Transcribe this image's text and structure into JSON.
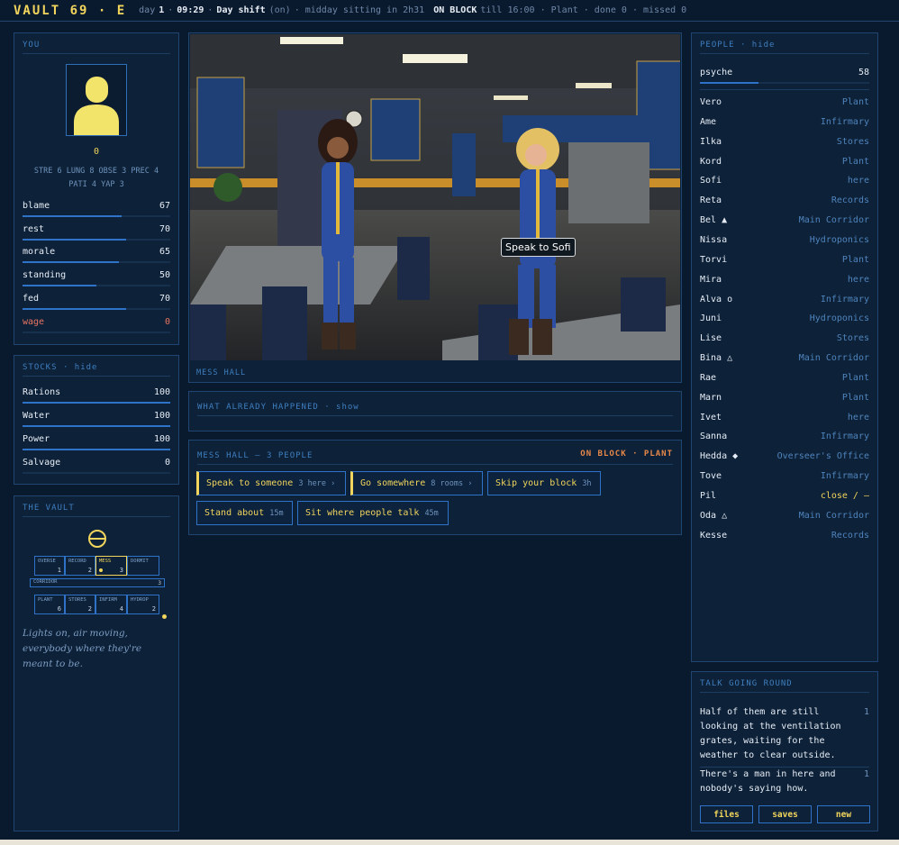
{
  "topbar": {
    "title": "VAULT 69 · E",
    "day_label": "day",
    "day": "1",
    "sep1": "·",
    "time": "09:29",
    "sep2": "·",
    "shift": "Day shift",
    "shift_status": "(on)",
    "sitting": "· midday sitting in 2h31",
    "block_label": "ON BLOCK",
    "block_rest": "till 16:00 · Plant · done 0 · missed 0"
  },
  "you": {
    "title": "YOU",
    "zero": "0",
    "attrs_line1": "STRE 6  LUNG 8  OBSE 3  PREC 4",
    "attrs_line2": "PATI 4  YAP 3",
    "stats": [
      {
        "label": "blame",
        "value": "67",
        "fill": 0.67
      },
      {
        "label": "rest",
        "value": "70",
        "fill": 0.7
      },
      {
        "label": "morale",
        "value": "65",
        "fill": 0.65
      },
      {
        "label": "standing",
        "value": "50",
        "fill": 0.5
      },
      {
        "label": "fed",
        "value": "70",
        "fill": 0.7
      },
      {
        "label": "wage",
        "value": "0",
        "fill": 0
      }
    ]
  },
  "stocks": {
    "title": "STOCKS",
    "toggle": "· hide",
    "items": [
      {
        "label": "Rations",
        "value": "100",
        "fill": 1
      },
      {
        "label": "Water",
        "value": "100",
        "fill": 1
      },
      {
        "label": "Power",
        "value": "100",
        "fill": 1
      },
      {
        "label": "Salvage",
        "value": "0",
        "fill": 0
      }
    ]
  },
  "vault": {
    "title": "THE VAULT",
    "rooms": [
      {
        "name": "OVERSE",
        "count": "1"
      },
      {
        "name": "RECORD",
        "count": "2"
      },
      {
        "name": "MESS",
        "count": "3"
      },
      {
        "name": "DORMIT",
        "count": ""
      },
      {
        "name": "CORRIDOR",
        "count": "3"
      },
      {
        "name": "PLANT",
        "count": "6"
      },
      {
        "name": "STORES",
        "count": "2"
      },
      {
        "name": "INFIRM",
        "count": "4"
      },
      {
        "name": "HYDROP",
        "count": "2"
      }
    ],
    "flavor": "Lights on, air moving, everybody where they're meant to be."
  },
  "scene": {
    "location": "MESS HALL",
    "tooltip": "Speak to Sofi"
  },
  "history": {
    "title": "WHAT ALREADY HAPPENED",
    "toggle": "· show"
  },
  "actions": {
    "title": "MESS HALL — 3 PEOPLE",
    "status": "ON BLOCK · PLANT",
    "buttons": [
      {
        "label": "Speak to someone",
        "hint": "3 here ›"
      },
      {
        "label": "Go somewhere",
        "hint": "8 rooms ›"
      },
      {
        "label": "Skip your block",
        "hint": "3h"
      },
      {
        "label": "Stand about",
        "hint": "15m"
      },
      {
        "label": "Sit where people talk",
        "hint": "45m"
      }
    ]
  },
  "people": {
    "title": "PEOPLE",
    "toggle": "· hide",
    "psyche_label": "psyche",
    "psyche_value": "58",
    "psyche_fill": 0.58,
    "list": [
      {
        "name": "Vero",
        "loc": "Plant"
      },
      {
        "name": "Ame",
        "loc": "Infirmary"
      },
      {
        "name": "Ilka",
        "loc": "Stores"
      },
      {
        "name": "Kord",
        "loc": "Plant"
      },
      {
        "name": "Sofi",
        "loc": "here"
      },
      {
        "name": "Reta",
        "loc": "Records"
      },
      {
        "name": "Bel ▲",
        "loc": "Main Corridor"
      },
      {
        "name": "Nissa",
        "loc": "Hydroponics"
      },
      {
        "name": "Torvi",
        "loc": "Plant"
      },
      {
        "name": "Mira",
        "loc": "here"
      },
      {
        "name": "Alva o",
        "loc": "Infirmary"
      },
      {
        "name": "Juni",
        "loc": "Hydroponics"
      },
      {
        "name": "Lise",
        "loc": "Stores"
      },
      {
        "name": "Bina △",
        "loc": "Main Corridor"
      },
      {
        "name": "Rae",
        "loc": "Plant"
      },
      {
        "name": "Marn",
        "loc": "Plant"
      },
      {
        "name": "Ivet",
        "loc": "here"
      },
      {
        "name": "Sanna",
        "loc": "Infirmary"
      },
      {
        "name": "Hedda ◆",
        "loc": "Overseer's Office"
      },
      {
        "name": "Tove",
        "loc": "Infirmary"
      },
      {
        "name": "Pil",
        "loc": "close / —"
      },
      {
        "name": "Oda △",
        "loc": "Main Corridor"
      },
      {
        "name": "Kesse",
        "loc": "Records"
      }
    ]
  },
  "talk": {
    "title": "TALK GOING ROUND",
    "items": [
      {
        "text": "Half of them are still looking at the ventilation grates, waiting for the weather to clear outside.",
        "count": "1"
      },
      {
        "text": "There's a man in here and nobody's saying how.",
        "count": "1"
      }
    ],
    "buttons": [
      "files",
      "saves",
      "new"
    ]
  },
  "colors": {
    "accent": "#f2d55c",
    "bar": "#2f73c9",
    "warn": "#e87461",
    "bg": "#0a1a2e"
  }
}
